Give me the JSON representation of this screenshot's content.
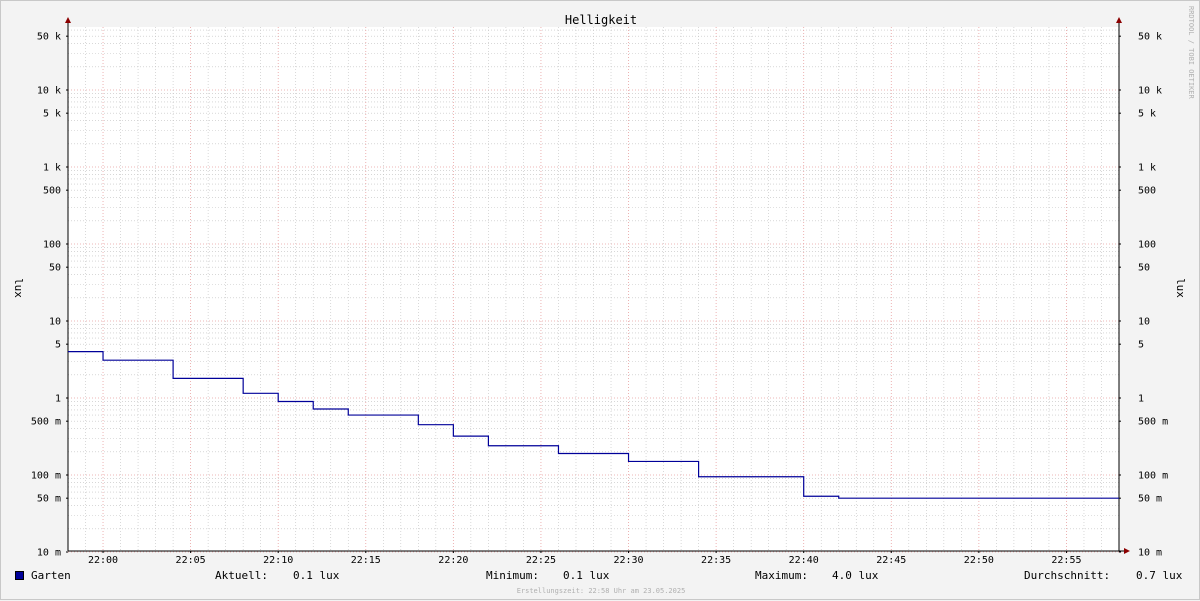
{
  "chart_data": {
    "type": "line",
    "title": "Helligkeit",
    "ylabel": "lux",
    "y_scale": "log",
    "ylim": [
      10,
      100000
    ],
    "y_ticks": [
      {
        "value": 50000,
        "label": "50 k"
      },
      {
        "value": 10000,
        "label": "10 k"
      },
      {
        "value": 5000,
        "label": "5 k"
      },
      {
        "value": 1000,
        "label": "1 k"
      },
      {
        "value": 500,
        "label": "500"
      },
      {
        "value": 100,
        "label": "100"
      },
      {
        "value": 50,
        "label": "50"
      },
      {
        "value": 10,
        "label": "10"
      },
      {
        "value": 5,
        "label": "5"
      },
      {
        "value": 1,
        "label": "1"
      },
      {
        "value": 0.5,
        "label": "500 m"
      },
      {
        "value": 0.1,
        "label": "100 m"
      },
      {
        "value": 0.05,
        "label": "50 m"
      },
      {
        "value": 0.01,
        "label": "10 m"
      }
    ],
    "x_ticks": [
      "22:00",
      "22:05",
      "22:10",
      "22:15",
      "22:20",
      "22:25",
      "22:30",
      "22:35",
      "22:40",
      "22:45",
      "22:50",
      "22:55"
    ],
    "x_range": [
      "21:58",
      "22:58"
    ],
    "grid": true,
    "series": [
      {
        "name": "Garten",
        "color": "#000099",
        "step": true,
        "points": [
          {
            "t": "21:58",
            "v": 4.0
          },
          {
            "t": "22:00",
            "v": 3.1
          },
          {
            "t": "22:04",
            "v": 1.8
          },
          {
            "t": "22:08",
            "v": 1.15
          },
          {
            "t": "22:10",
            "v": 0.9
          },
          {
            "t": "22:12",
            "v": 0.72
          },
          {
            "t": "22:14",
            "v": 0.6
          },
          {
            "t": "22:18",
            "v": 0.45
          },
          {
            "t": "22:20",
            "v": 0.32
          },
          {
            "t": "22:22",
            "v": 0.24
          },
          {
            "t": "22:26",
            "v": 0.19
          },
          {
            "t": "22:30",
            "v": 0.15
          },
          {
            "t": "22:34",
            "v": 0.095
          },
          {
            "t": "22:40",
            "v": 0.053
          },
          {
            "t": "22:42",
            "v": 0.05
          },
          {
            "t": "22:58",
            "v": 0.05
          }
        ]
      }
    ],
    "colors": {
      "major_grid": "#e8a0a0",
      "minor_grid": "#c0c0c0",
      "arrow": "#8b0000"
    }
  },
  "watermark": "RRDTOOL / TOBI OETIKER",
  "footer": "Erstellungszeit: 22:58 Uhr am 23.05.2025",
  "legend": {
    "series_name": "Garten",
    "aktuell_label": "Aktuell:",
    "aktuell_value": "0.1 lux",
    "minimum_label": "Minimum:",
    "minimum_value": "0.1 lux",
    "maximum_label": "Maximum:",
    "maximum_value": "4.0 lux",
    "durchschnitt_label": "Durchschnitt:",
    "durchschnitt_value": "0.7 lux"
  }
}
